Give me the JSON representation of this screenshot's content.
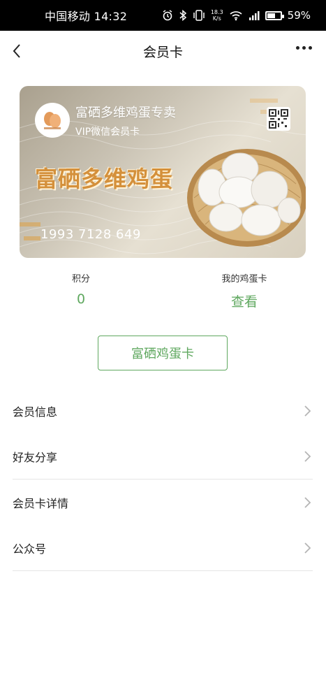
{
  "status_bar": {
    "carrier_time": "中国移动 14:32",
    "net_speed_value": "18.3",
    "net_speed_unit": "K/s",
    "battery": "59%",
    "battery_level": 0.59,
    "icons": [
      "alarm-icon",
      "bluetooth-icon",
      "vibrate-icon",
      "wifi-icon",
      "signal-icon",
      "battery-icon"
    ]
  },
  "nav": {
    "title": "会员卡",
    "back_icon": "chevron-left-icon",
    "more_icon": "more-icon"
  },
  "card": {
    "title": "富硒多维鸡蛋专卖",
    "subtitle": "VIP微信会员卡",
    "brand_text": "富硒多维鸡蛋",
    "number": "1993 7128 649",
    "qr_icon": "qr-code-icon",
    "logo_icon": "egg-logo-icon",
    "colors": {
      "brand_text": "#d4903b",
      "background": "#c9c2b3"
    }
  },
  "stats": {
    "points_label": "积分",
    "points_value": "0",
    "egg_card_label": "我的鸡蛋卡",
    "egg_card_value": "查看"
  },
  "primary_button": "富硒鸡蛋卡",
  "menu": [
    {
      "label": "会员信息"
    },
    {
      "label": "好友分享"
    },
    {
      "label": "会员卡详情"
    },
    {
      "label": "公众号"
    }
  ],
  "colors": {
    "accent": "#5fa85f",
    "divider": "#e5e5e5"
  }
}
